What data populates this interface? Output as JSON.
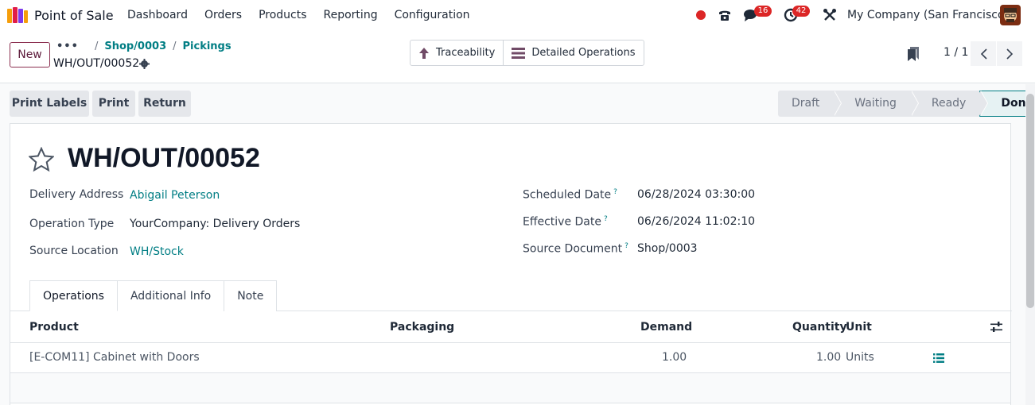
{
  "navbar": {
    "app_name": "Point of Sale",
    "menu": [
      "Dashboard",
      "Orders",
      "Products",
      "Reporting",
      "Configuration"
    ],
    "messages_count": "16",
    "activities_count": "42",
    "company": "My Company (San Francisco)"
  },
  "control": {
    "new_label": "New",
    "breadcrumb": [
      "Shop/0003",
      "Pickings"
    ],
    "record_name": "WH/OUT/00052",
    "smart_buttons": [
      "Traceability",
      "Detailed Operations"
    ],
    "pager": "1 / 1"
  },
  "actions": [
    "Print Labels",
    "Print",
    "Return"
  ],
  "status": {
    "stages": [
      "Draft",
      "Waiting",
      "Ready",
      "Done"
    ],
    "active": "Done"
  },
  "form": {
    "title": "WH/OUT/00052",
    "left_fields": [
      {
        "label": "Delivery Address",
        "value": "Abigail Peterson"
      },
      {
        "label": "Operation Type",
        "value": "YourCompany: Delivery Orders"
      },
      {
        "label": "Source Location",
        "value": "WH/Stock"
      }
    ],
    "right_fields": [
      {
        "label": "Scheduled Date",
        "value": "06/28/2024 03:30:00"
      },
      {
        "label": "Effective Date",
        "value": "06/26/2024 11:02:10"
      },
      {
        "label": "Source Document",
        "value": "Shop/0003"
      }
    ],
    "help_mark": "?"
  },
  "tabs": [
    "Operations",
    "Additional Info",
    "Note"
  ],
  "table": {
    "headers": [
      "Product",
      "Packaging",
      "Demand",
      "Quantity",
      "Unit"
    ],
    "rows": [
      {
        "product": "[E-COM11] Cabinet with Doors",
        "packaging": "",
        "demand": "1.00",
        "quantity": "1.00",
        "unit": "Units"
      }
    ]
  },
  "colors": {
    "accent": "#017e84",
    "brand": "#714b67",
    "badge": "#dc2626"
  }
}
